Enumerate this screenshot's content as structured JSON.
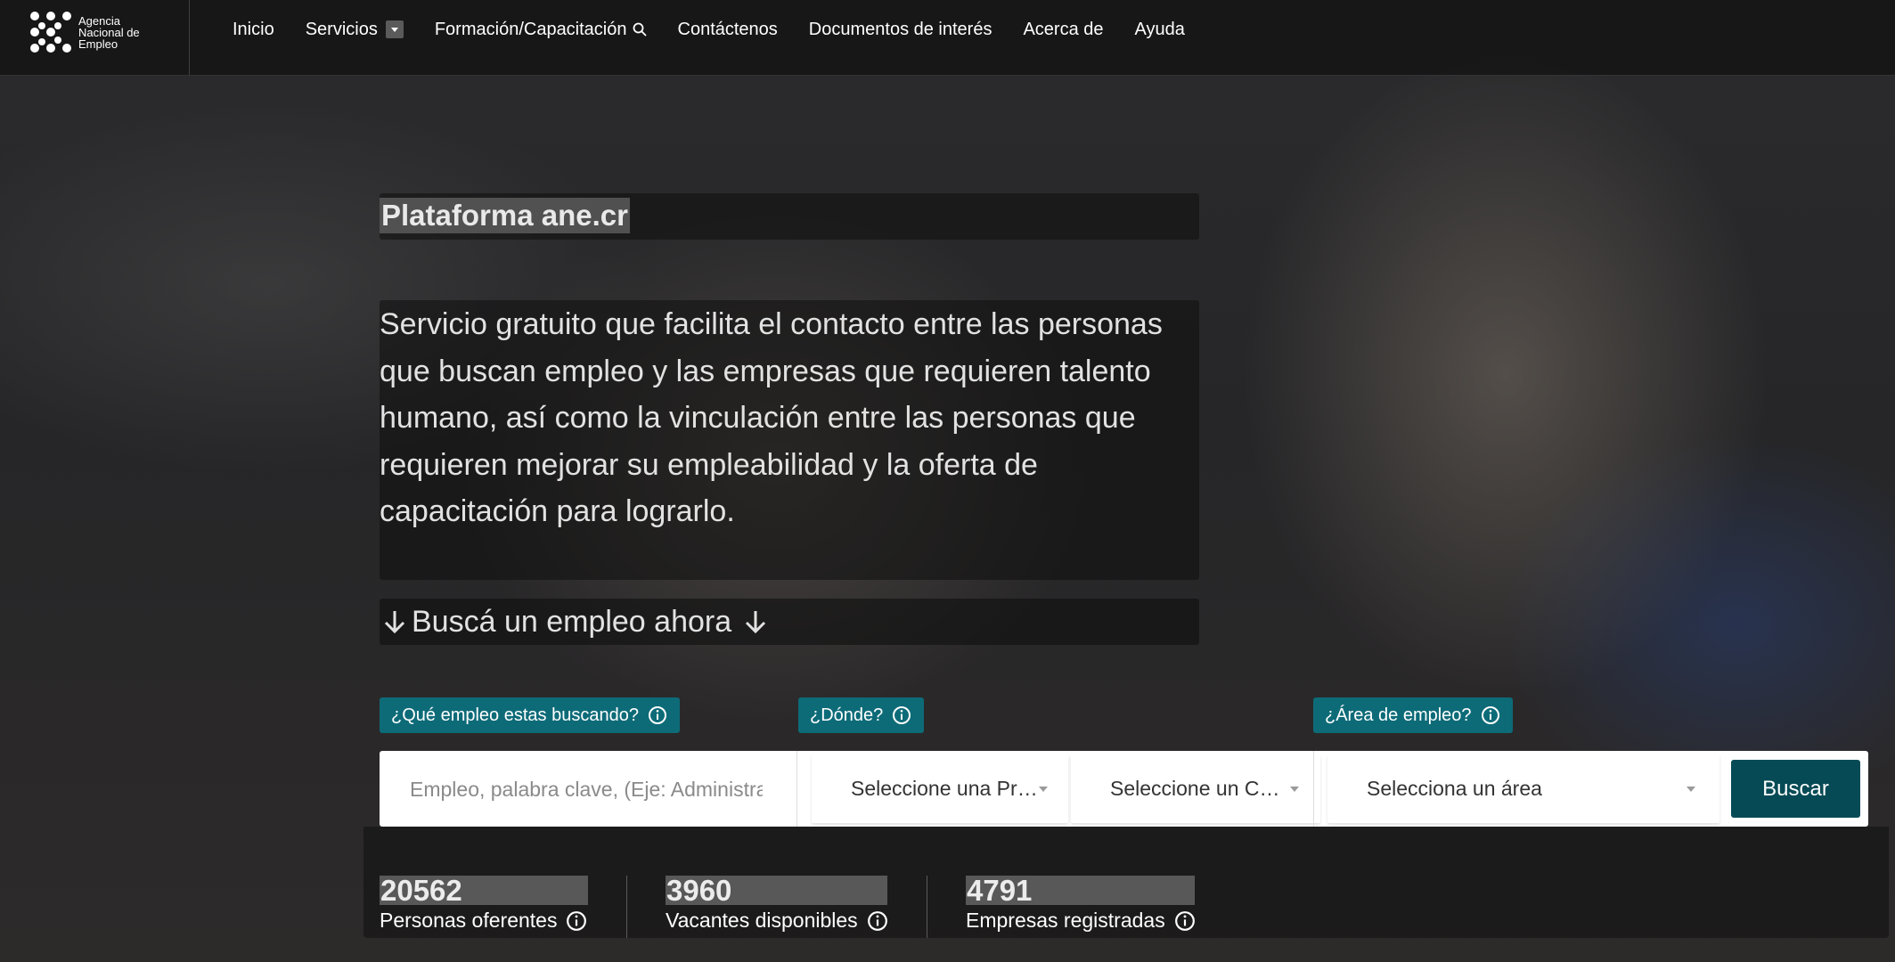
{
  "brand": {
    "logo_lines": [
      "Agencia",
      "Nacional de",
      "Empleo"
    ]
  },
  "nav": {
    "items": [
      {
        "label": "Inicio"
      },
      {
        "label": "Servicios"
      },
      {
        "label": "Formación/Capacitación"
      },
      {
        "label": "Contáctenos"
      },
      {
        "label": "Documentos de interés"
      },
      {
        "label": "Acerca de"
      },
      {
        "label": "Ayuda"
      }
    ]
  },
  "hero": {
    "title": "Plataforma ane.cr",
    "description": "Servicio gratuito que facilita el contacto entre las personas que buscan empleo y las empresas que requieren talento humano, así como la vinculación entre las personas que requieren mejorar su empleabilidad y la oferta de capacitación para lograrlo.",
    "cta": "Buscá un empleo ahora"
  },
  "search": {
    "labels": {
      "what": "¿Qué empleo estas buscando?",
      "where": "¿Dónde?",
      "area": "¿Área de empleo?"
    },
    "keyword_placeholder": "Empleo, palabra clave, (Eje: Administrac",
    "province_select": "Seleccione una Pro…",
    "canton_select": "Seleccione un C…",
    "area_select": "Selecciona un área",
    "submit_label": "Buscar"
  },
  "stats": [
    {
      "value": "20562",
      "label": "Personas oferentes"
    },
    {
      "value": "3960",
      "label": "Vacantes disponibles"
    },
    {
      "value": "4791",
      "label": "Empresas registradas"
    }
  ],
  "colors": {
    "accent_teal": "#0d6b78",
    "button_dark_teal": "#064a55"
  }
}
